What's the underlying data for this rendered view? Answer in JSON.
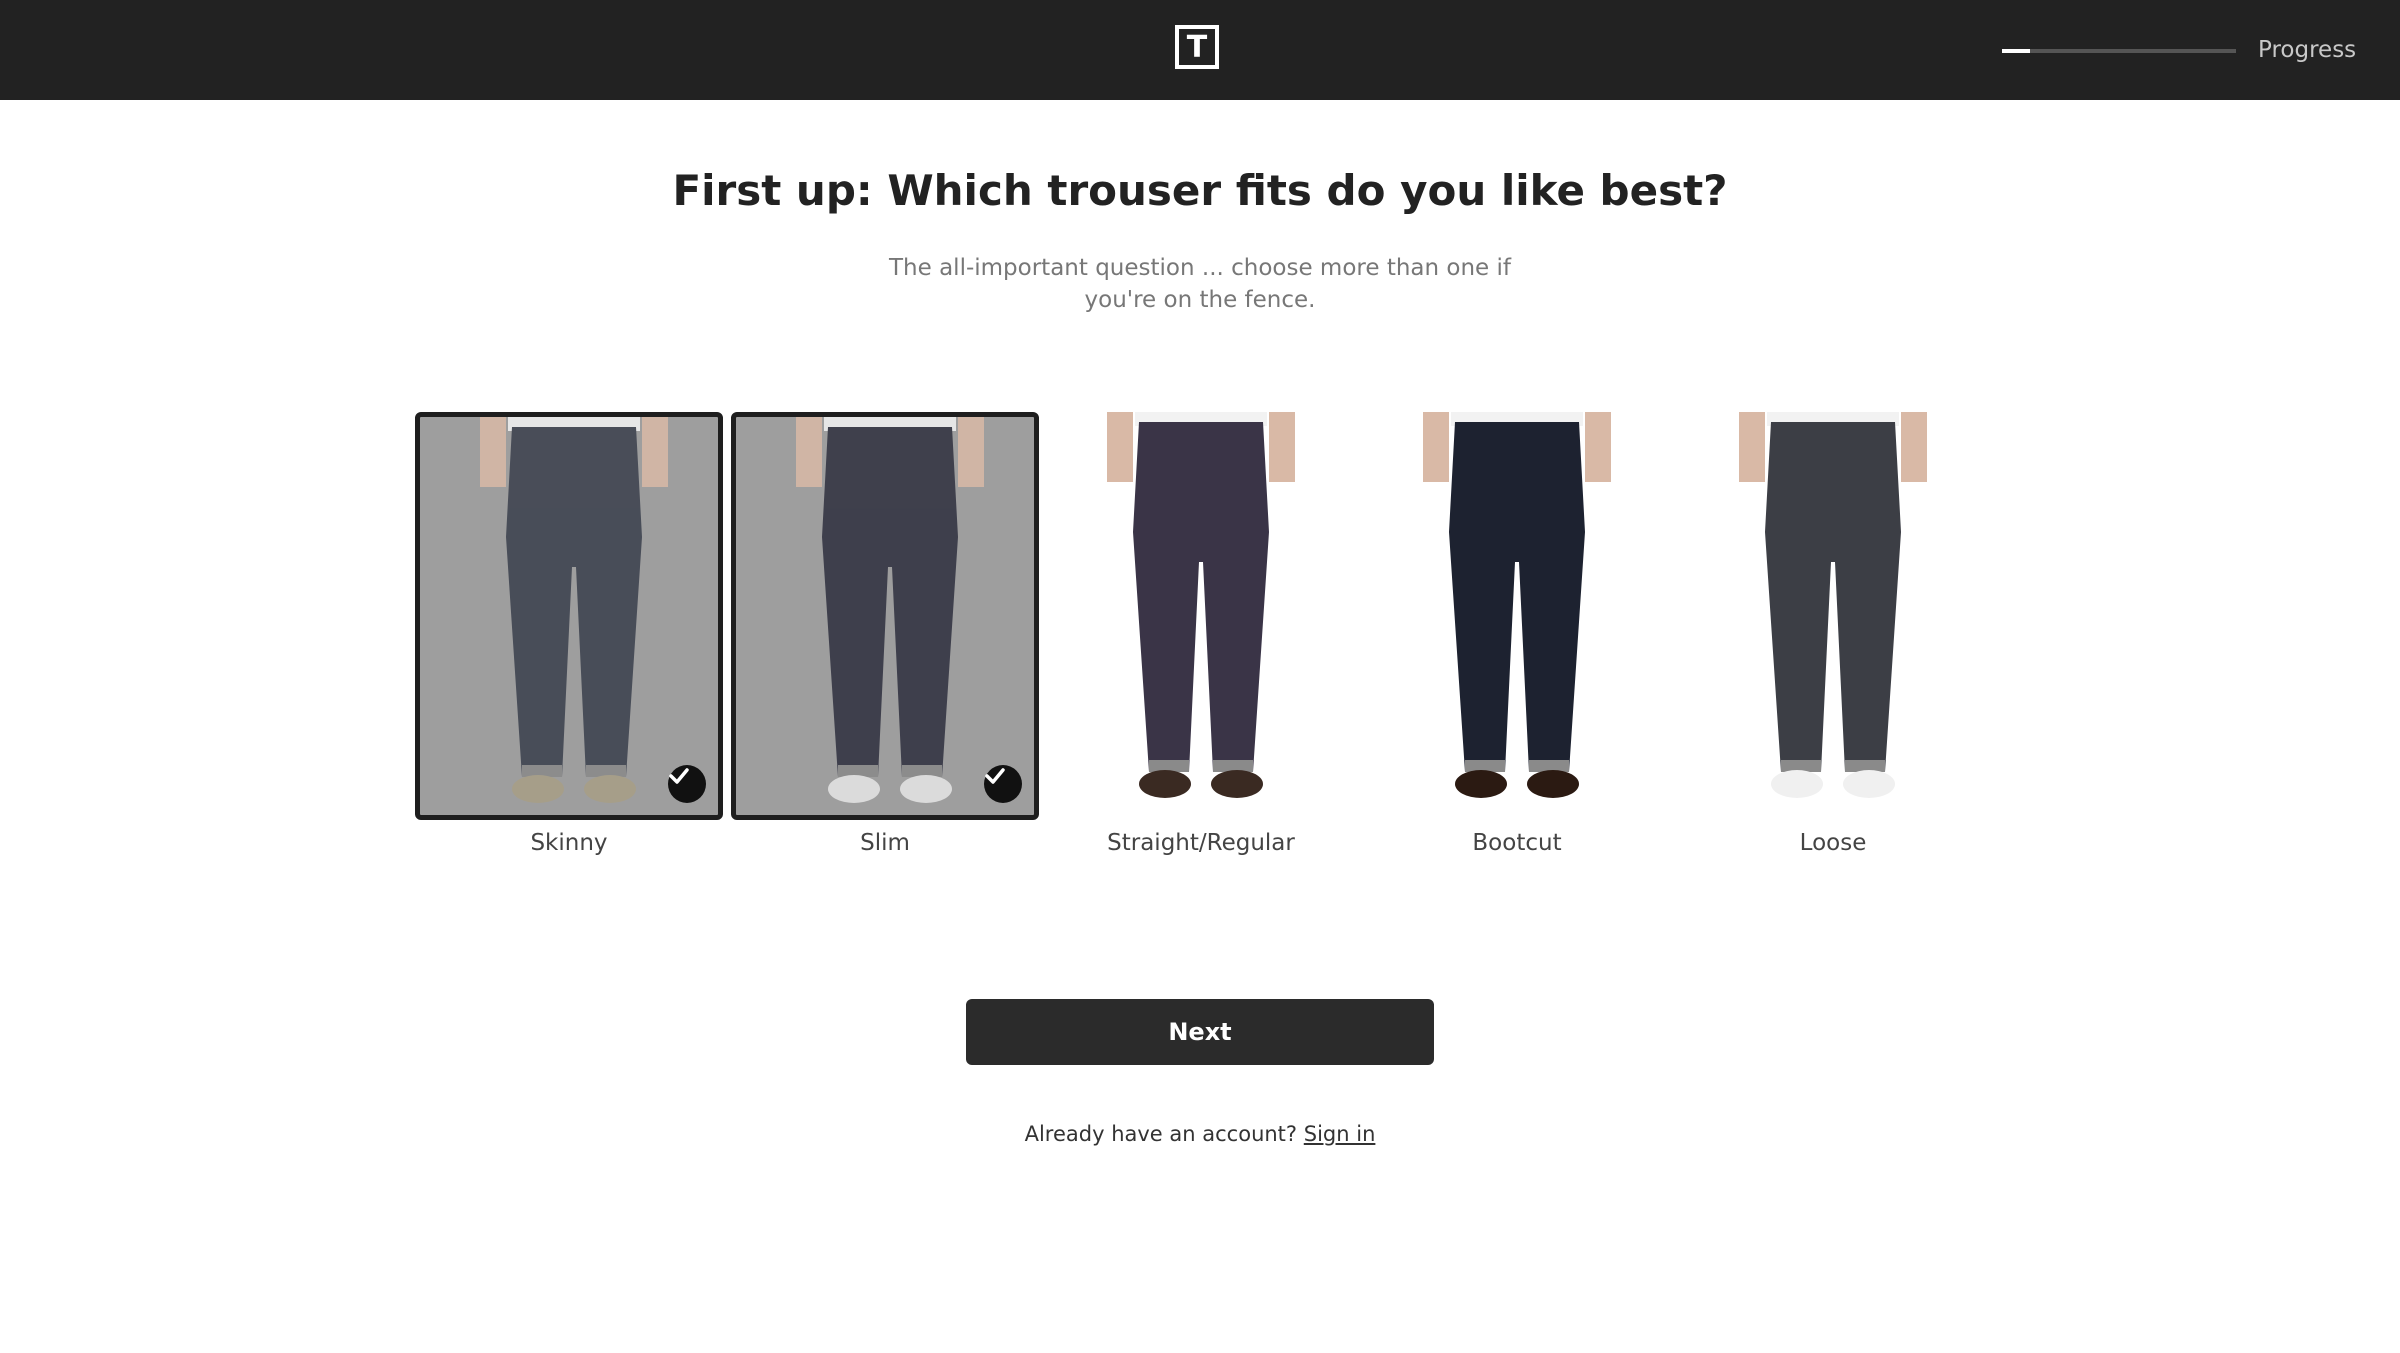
{
  "header": {
    "logo_text": "T",
    "progress_label": "Progress",
    "progress_fraction": 0.12
  },
  "main": {
    "title": "First up: Which trouser fits do you like best?",
    "subtitle": "The all-important question ... choose more than one if you're on the fence.",
    "options": [
      {
        "label": "Skinny",
        "selected": true,
        "jean": "#3a3f4c",
        "shoe": "#a89f86"
      },
      {
        "label": "Slim",
        "selected": true,
        "jean": "#2e2f3e",
        "shoe": "#e6e6e6"
      },
      {
        "label": "Straight/Regular",
        "selected": false,
        "jean": "#3a3447",
        "shoe": "#3a2a22"
      },
      {
        "label": "Bootcut",
        "selected": false,
        "jean": "#1d2230",
        "shoe": "#2b1a12"
      },
      {
        "label": "Loose",
        "selected": false,
        "jean": "#3c3e45",
        "shoe": "#f0f0f0"
      }
    ],
    "next_label": "Next",
    "account_prompt": "Already have an account?",
    "sign_in_label": "Sign in"
  },
  "colors": {
    "topbar": "#222222",
    "button": "#2b2b2b",
    "selected_overlay": "#9e9e9e"
  }
}
